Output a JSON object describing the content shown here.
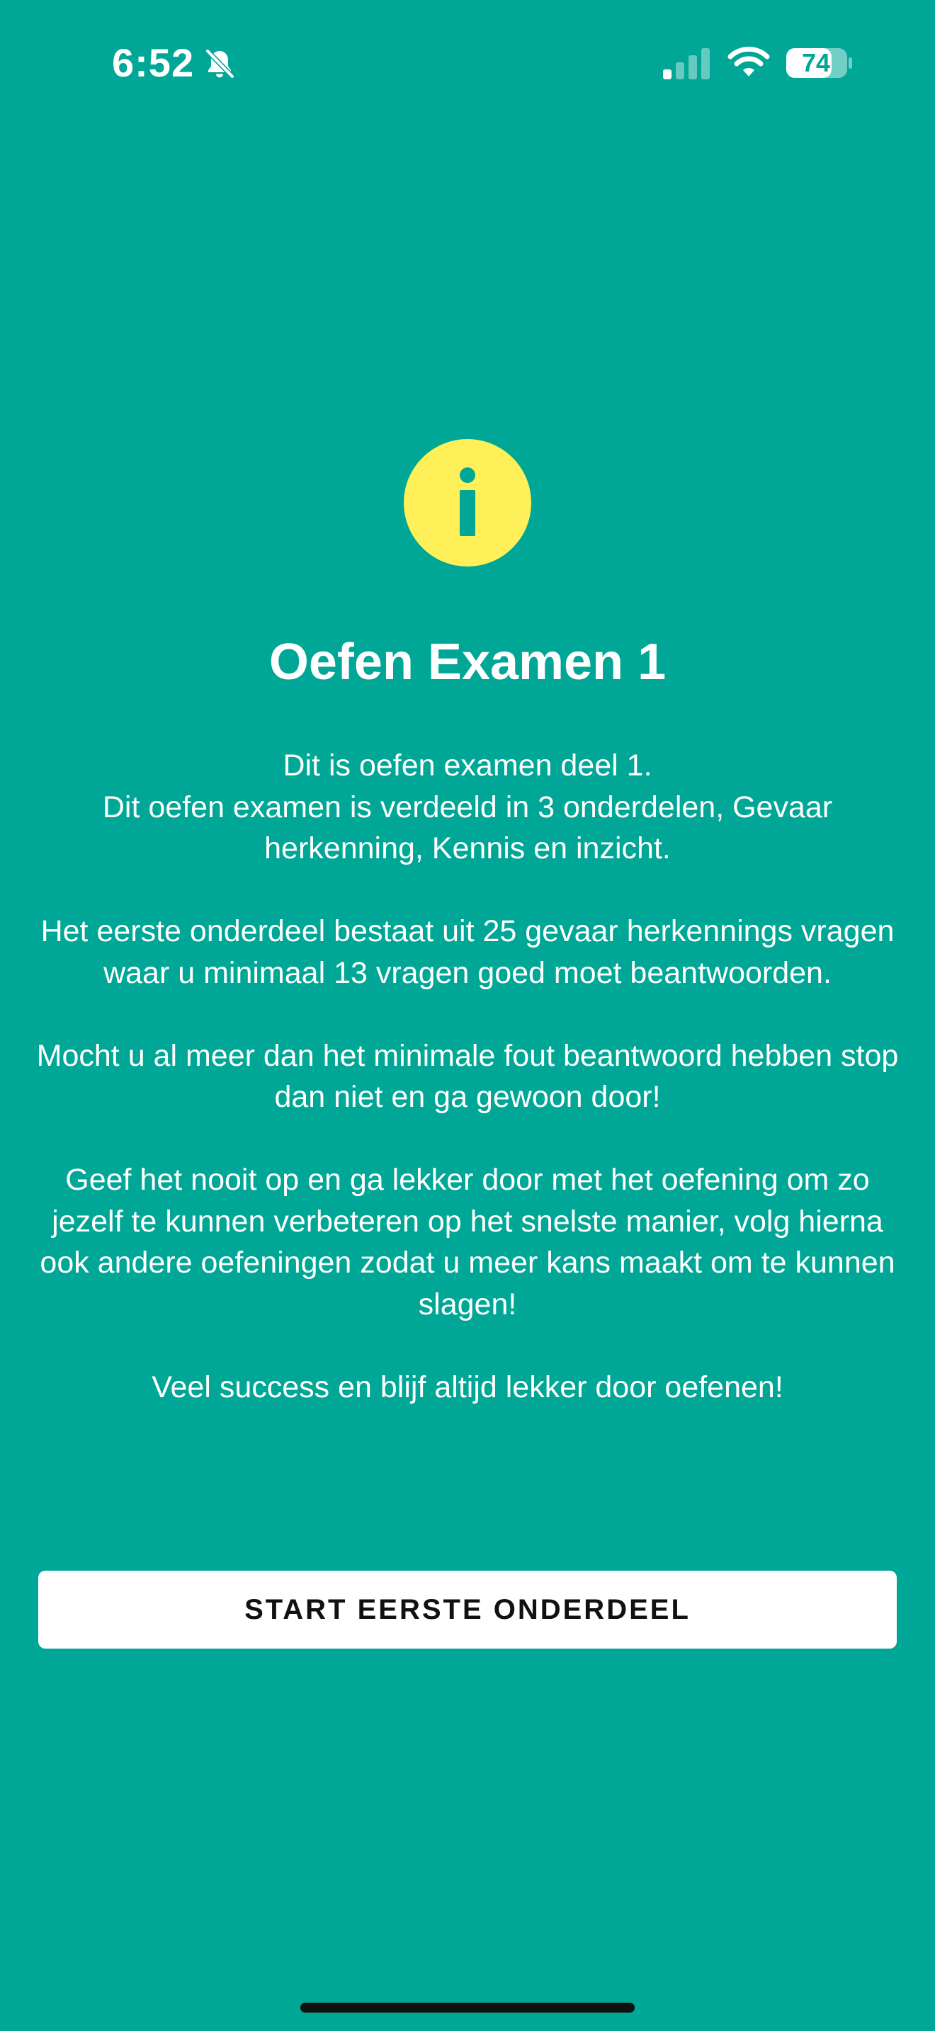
{
  "status_bar": {
    "time": "6:52",
    "battery_level": "74",
    "icons": [
      "bell-slash-icon",
      "cellular-signal-icon",
      "wifi-icon",
      "battery-icon"
    ]
  },
  "colors": {
    "background": "#00A796",
    "info_icon": "#FFF05A",
    "button_bg": "#FFFFFF",
    "button_text": "#111111"
  },
  "main": {
    "icon": "info-icon",
    "title": "Oefen Examen 1",
    "paragraphs": [
      {
        "line1": "Dit is oefen examen deel 1.",
        "line2": "Dit oefen examen is verdeeld in 3 onderdelen, Gevaar herkenning, Kennis en inzicht."
      },
      "Het eerste onderdeel bestaat uit 25 gevaar herkennings vragen waar u minimaal 13 vragen goed moet beantwoorden.",
      "Mocht u al meer dan het minimale fout beantwoord hebben stop dan niet en ga gewoon door!",
      "Geef het nooit op en ga lekker door met het oefening om zo jezelf te kunnen verbeteren op het snelste manier, volg hierna ook andere oefeningen zodat u meer kans maakt om te kunnen slagen!",
      "Veel success en blijf altijd lekker door oefenen!"
    ],
    "start_button_label": "START EERSTE ONDERDEEL"
  }
}
